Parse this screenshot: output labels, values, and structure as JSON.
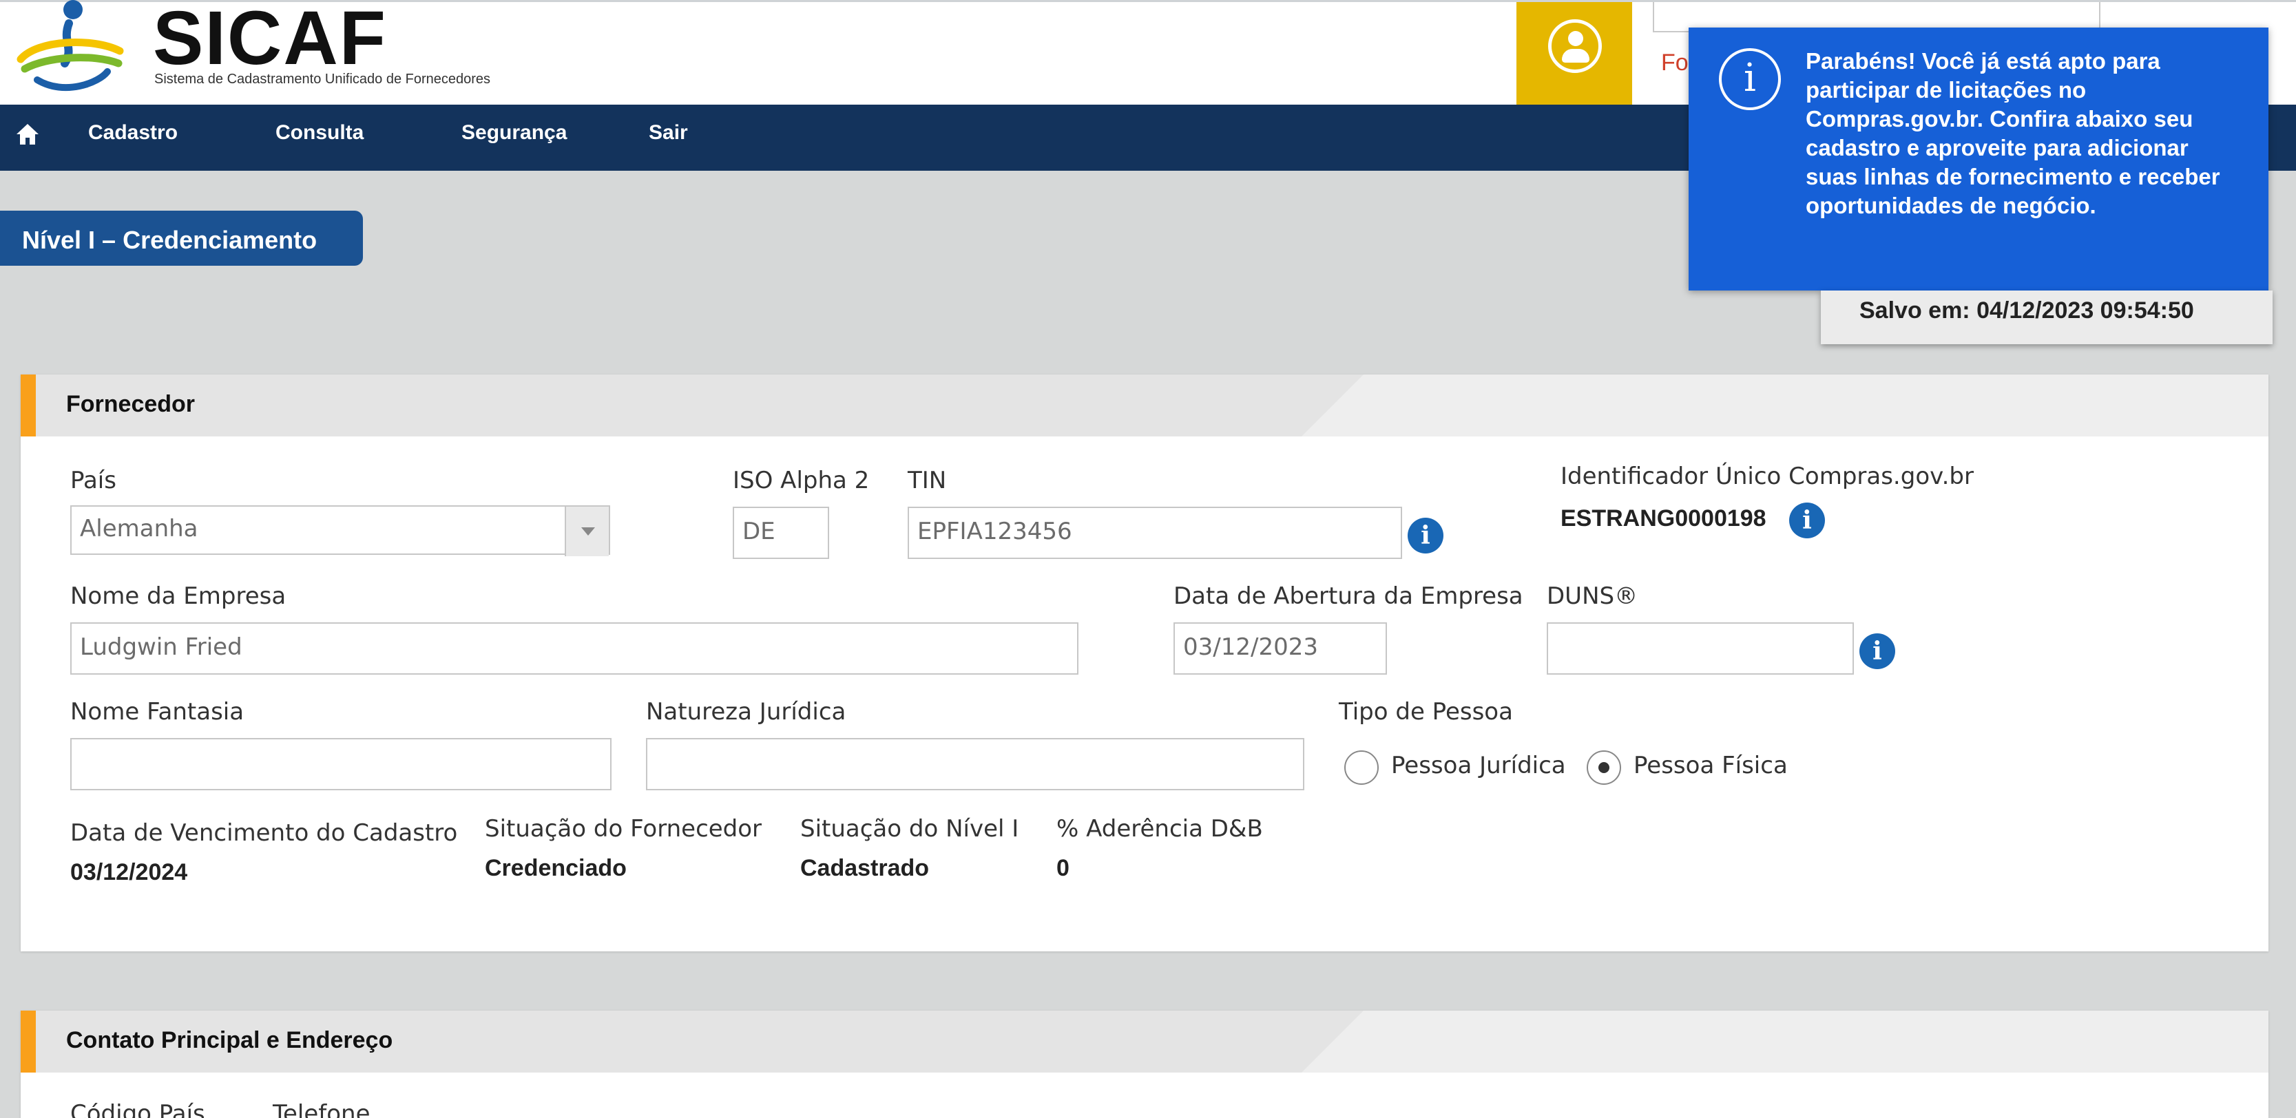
{
  "header": {
    "app_name": "SICAF",
    "subtitle": "Sistema de Cadastramento Unificado de Fornecedores",
    "partial_link": "Fornecedor E"
  },
  "nav": {
    "items": [
      "Cadastro",
      "Consulta",
      "Segurança",
      "Sair"
    ]
  },
  "page_tab": "Nível I – Credenciamento",
  "toast": {
    "message": "Parabéns! Você já está apto para participar de licitações no Compras.gov.br. Confira abaixo seu cadastro e aproveite para adicionar suas linhas de fornecimento e receber oportunidades de negócio.",
    "saved": "Salvo em: 04/12/2023 09:54:50"
  },
  "fornecedor": {
    "title": "Fornecedor",
    "pais_label": "País",
    "pais_value": "Alemanha",
    "iso_label": "ISO Alpha 2",
    "iso_value": "DE",
    "tin_label": "TIN",
    "tin_value": "EPFIA123456",
    "id_label": "Identificador Único Compras.gov.br",
    "id_value": "ESTRANG0000198",
    "empresa_label": "Nome da Empresa",
    "empresa_value": "Ludgwin Fried",
    "abertura_label": "Data de Abertura da Empresa",
    "abertura_value": "03/12/2023",
    "duns_label": "DUNS®",
    "duns_value": "",
    "fantasia_label": "Nome Fantasia",
    "fantasia_value": "",
    "natureza_label": "Natureza Jurídica",
    "natureza_value": "",
    "tipo_label": "Tipo de Pessoa",
    "tipo_options": [
      "Pessoa Jurídica",
      "Pessoa Física"
    ],
    "tipo_selected": "Pessoa Física",
    "vencimento_label": "Data de Vencimento do Cadastro",
    "vencimento_value": "03/12/2024",
    "situacao_label": "Situação do Fornecedor",
    "situacao_value": "Credenciado",
    "nivel_label": "Situação do Nível I",
    "nivel_value": "Cadastrado",
    "aderencia_label": "% Aderência D&B",
    "aderencia_value": "0"
  },
  "contato": {
    "title": "Contato Principal e Endereço",
    "codigo_label": "Código País",
    "telefone_label": "Telefone"
  },
  "colors": {
    "nav": "#13335c",
    "tab": "#1b5292",
    "toast": "#1660d7",
    "user_box": "#e5b700",
    "accent": "#f9a01b",
    "info": "#1967b5"
  },
  "icons": [
    "logo-icon",
    "user-icon",
    "home-icon",
    "toast-info-icon",
    "info-icon"
  ]
}
